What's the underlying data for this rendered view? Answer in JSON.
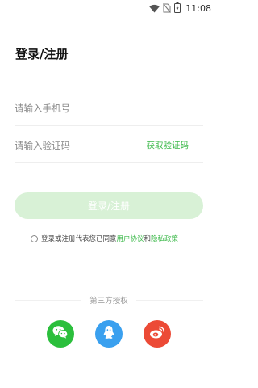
{
  "status_bar": {
    "time": "11:08"
  },
  "page": {
    "title": "登录/注册"
  },
  "form": {
    "phone_placeholder": "请输入手机号",
    "code_placeholder": "请输入验证码",
    "get_code_label": "获取验证码",
    "submit_label": "登录/注册"
  },
  "agreement": {
    "prefix": "登录或注册代表您已同意",
    "user_agreement": "用户协议",
    "and": "和",
    "privacy_policy": "隐私政策"
  },
  "third_party": {
    "label": "第三方授权",
    "providers": [
      "wechat-icon",
      "qq-icon",
      "weibo-icon"
    ]
  },
  "colors": {
    "accent": "#3cb94a",
    "button_disabled": "#d8f1d6",
    "wechat": "#2bbf3c",
    "qq": "#3aa0ef",
    "weibo": "#ec4a36"
  }
}
